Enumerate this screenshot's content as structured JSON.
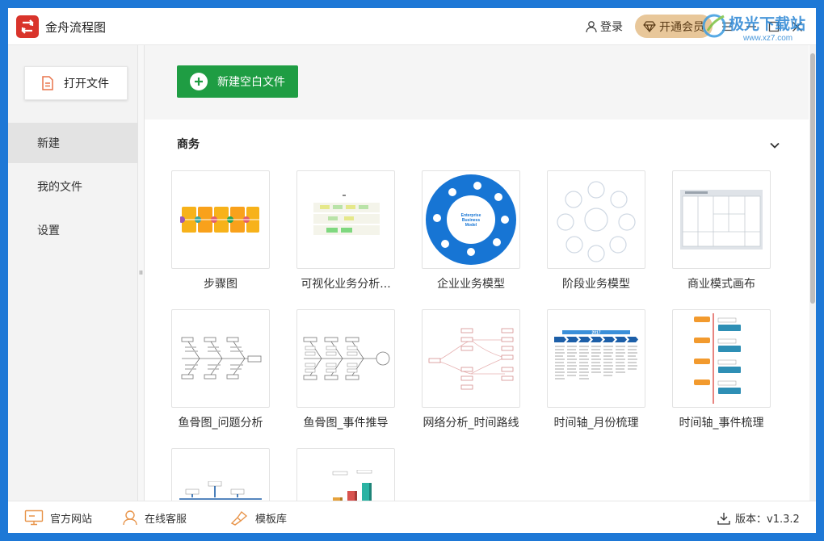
{
  "app": {
    "title": "金舟流程图"
  },
  "header": {
    "login_label": "登录",
    "vip_label": "开通会员"
  },
  "sidebar": {
    "open_label": "打开文件",
    "items": [
      {
        "label": "新建",
        "active": true
      },
      {
        "label": "我的文件",
        "active": false
      },
      {
        "label": "设置",
        "active": false
      }
    ]
  },
  "main": {
    "new_blank_label": "新建空白文件",
    "section_title": "商务",
    "templates": [
      {
        "label": "步骤图",
        "thumb": "steps"
      },
      {
        "label": "可视化业务分析...",
        "thumb": "visual"
      },
      {
        "label": "企业业务模型",
        "thumb": "enterprise"
      },
      {
        "label": "阶段业务模型",
        "thumb": "stages"
      },
      {
        "label": "商业模式画布",
        "thumb": "canvas"
      },
      {
        "label": "鱼骨图_问题分析",
        "thumb": "fishbone1"
      },
      {
        "label": "鱼骨图_事件推导",
        "thumb": "fishbone2"
      },
      {
        "label": "网络分析_时间路线",
        "thumb": "network"
      },
      {
        "label": "时间轴_月份梳理",
        "thumb": "timeline-month"
      },
      {
        "label": "时间轴_事件梳理",
        "thumb": "timeline-event"
      },
      {
        "label": "",
        "thumb": "flow-heading"
      },
      {
        "label": "",
        "thumb": "bars3d"
      }
    ],
    "thumb_texts": {
      "enterprise_center": "Enterprise Business Model",
      "timeline_year": "2017"
    }
  },
  "footer": {
    "website_label": "官方网站",
    "service_label": "在线客服",
    "template_label": "模板库",
    "version_label": "版本：v1.3.2"
  },
  "watermark": {
    "text": "极光下载站",
    "url": "www.xz7.com"
  },
  "colors": {
    "brand_red": "#d9342b",
    "accent_green": "#1f9d43",
    "vip_gold": "#e8c79a",
    "window_blue": "#1e78d6"
  }
}
